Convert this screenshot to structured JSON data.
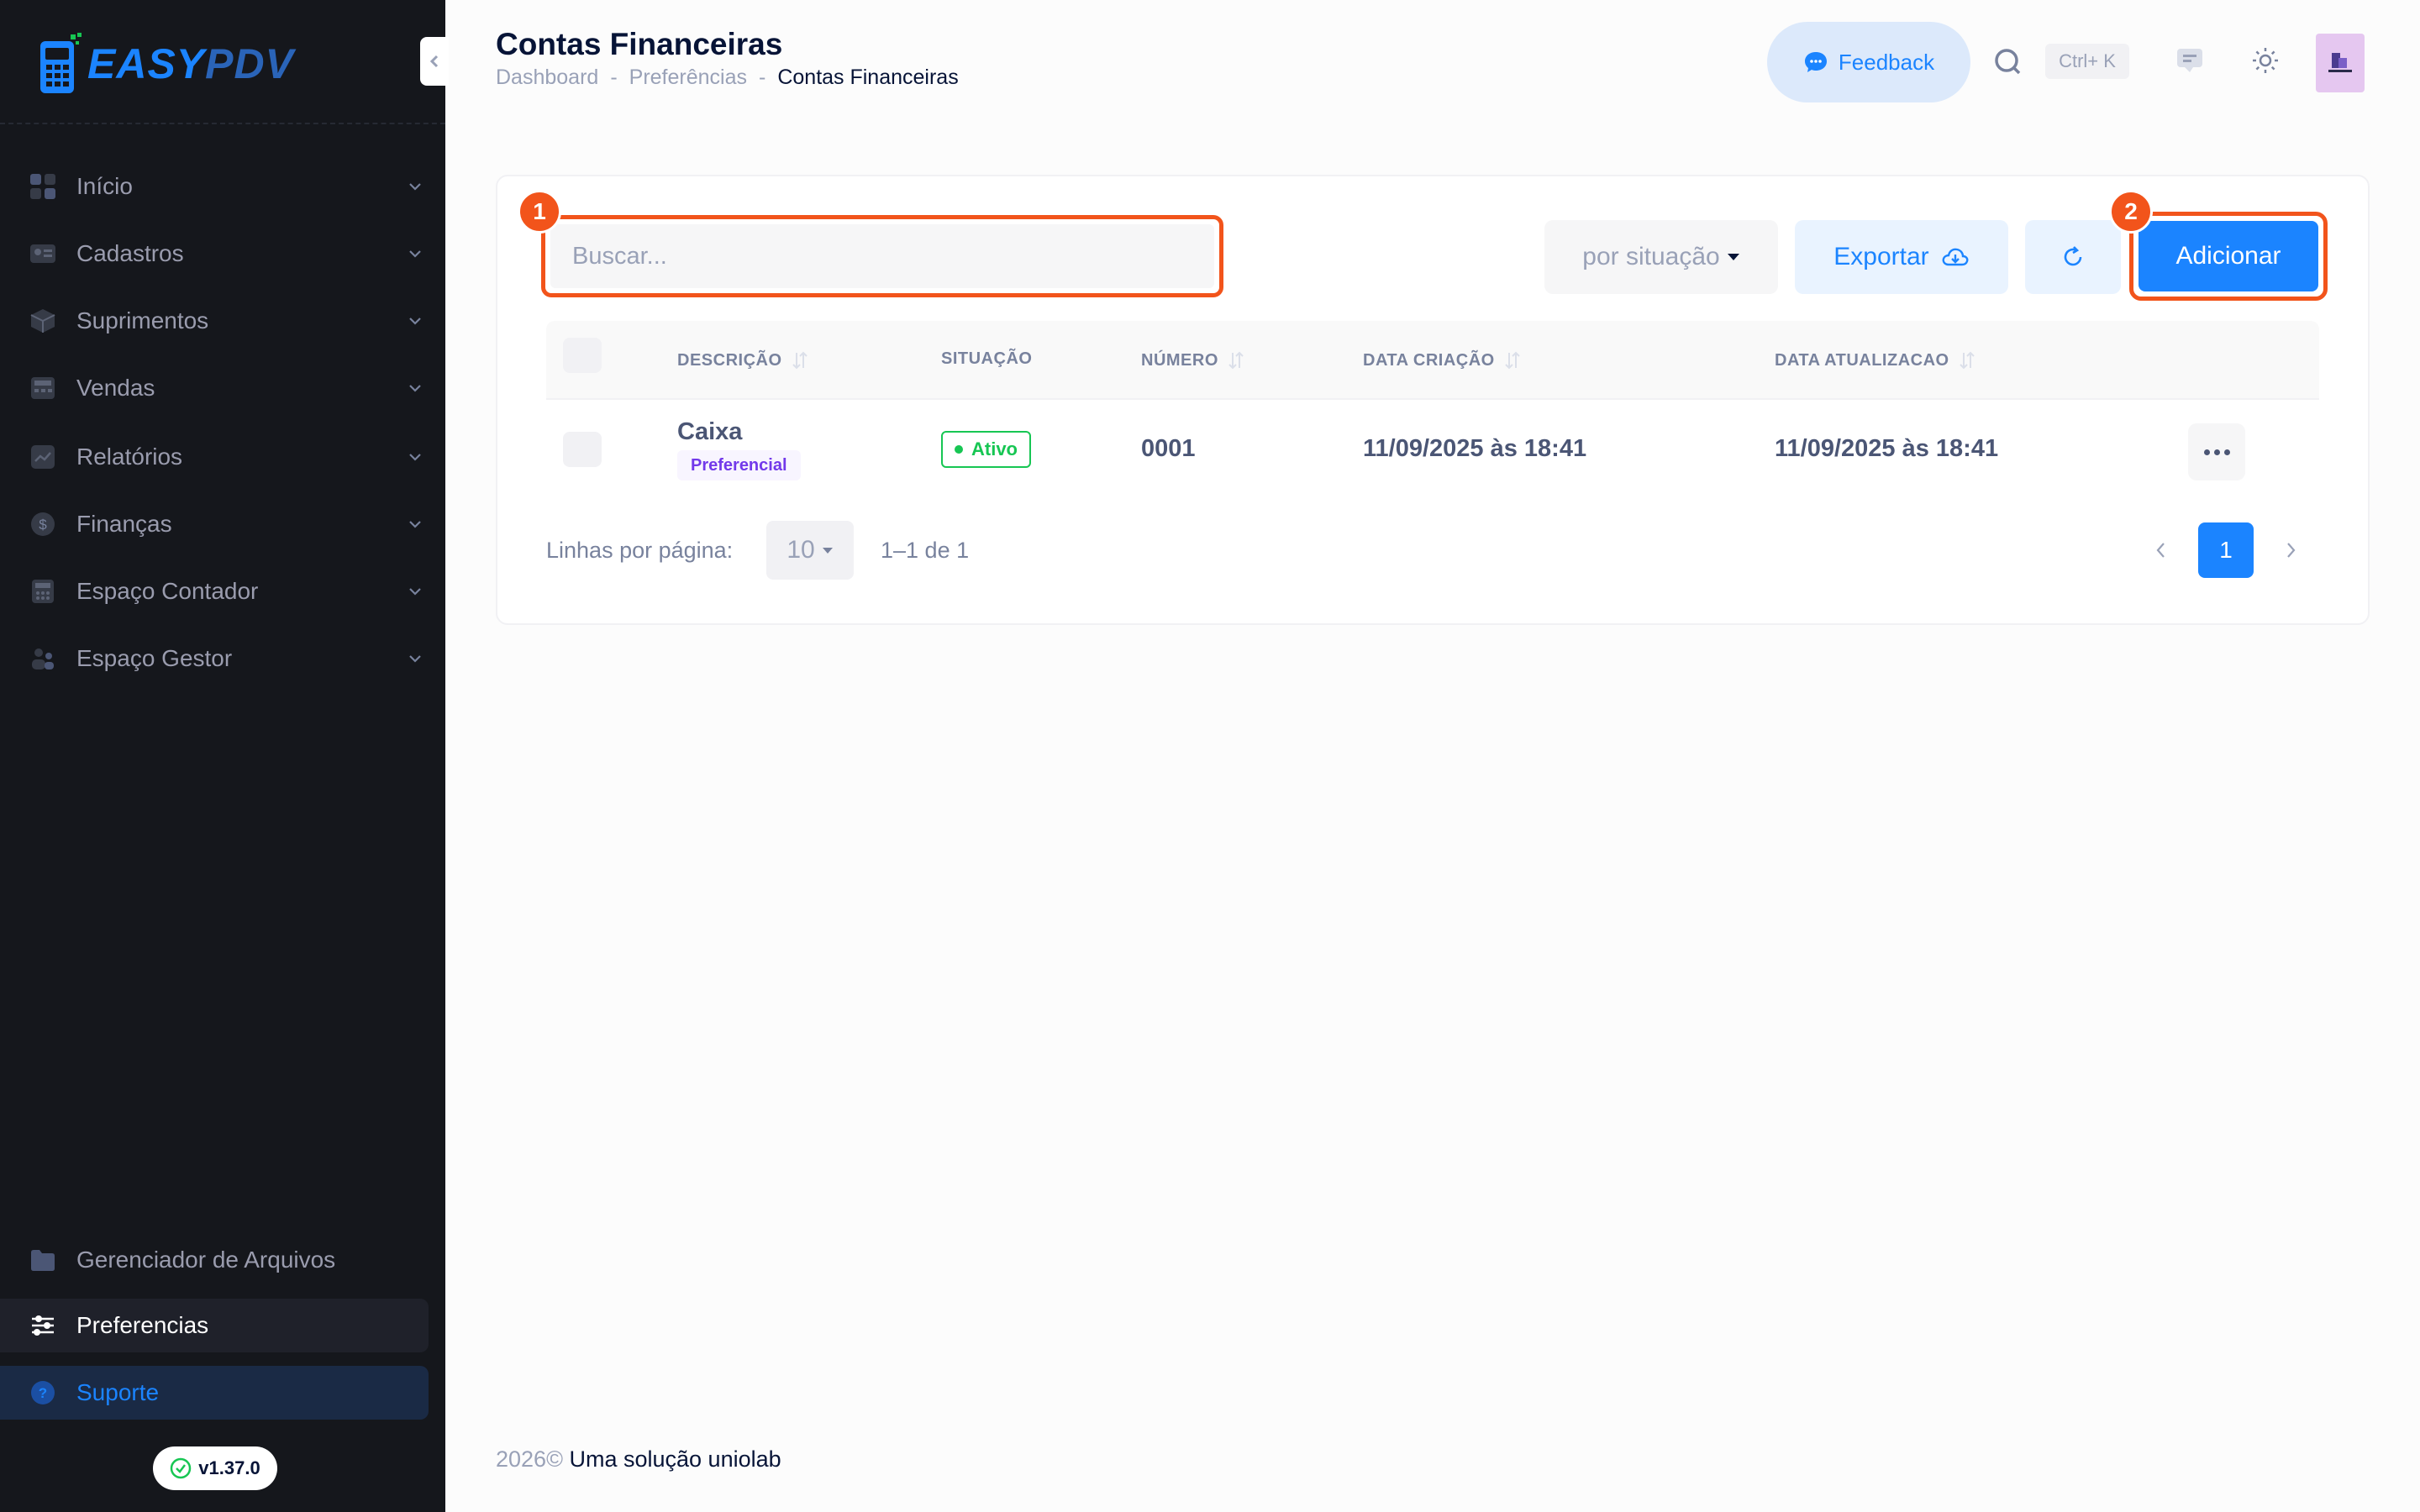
{
  "app": {
    "logo_text_1": "EASY",
    "logo_text_2": "PDV",
    "version": "v1.37.0",
    "colors": {
      "accent": "#1b84ff",
      "highlight": "#f2541b",
      "success": "#17c653",
      "sidebar_bg": "#15171c"
    }
  },
  "sidebar": {
    "items": [
      {
        "label": "Início",
        "icon": "dashboard-icon"
      },
      {
        "label": "Cadastros",
        "icon": "id-card-icon"
      },
      {
        "label": "Suprimentos",
        "icon": "box-icon"
      },
      {
        "label": "Vendas",
        "icon": "cash-register-icon"
      },
      {
        "label": "Relatórios",
        "icon": "chart-line-icon"
      },
      {
        "label": "Finanças",
        "icon": "dollar-icon"
      },
      {
        "label": "Espaço Contador",
        "icon": "calculator-icon"
      },
      {
        "label": "Espaço Gestor",
        "icon": "people-icon"
      }
    ],
    "bottom": {
      "files": "Gerenciador de Arquivos",
      "preferences": "Preferencias",
      "support": "Suporte"
    }
  },
  "header": {
    "title": "Contas Financeiras",
    "breadcrumb": [
      "Dashboard",
      "Preferências",
      "Contas Financeiras"
    ],
    "breadcrumb_sep": "-",
    "feedback_label": "Feedback",
    "search_shortcut": "Ctrl+ K"
  },
  "toolbar": {
    "search_placeholder": "Buscar...",
    "filter_label": "por situação",
    "export_label": "Exportar",
    "add_label": "Adicionar",
    "step_1": "1",
    "step_2": "2"
  },
  "table": {
    "columns": [
      "DESCRIÇÃO",
      "SITUAÇÃO",
      "NÚMERO",
      "DATA CRIAÇÃO",
      "DATA ATUALIZACAO"
    ],
    "rows": [
      {
        "descricao": "Caixa",
        "tag": "Preferencial",
        "situacao": "Ativo",
        "numero": "0001",
        "data_criacao": "11/09/2025 às 18:41",
        "data_atualizacao": "11/09/2025 às 18:41"
      }
    ]
  },
  "pagination": {
    "rows_label": "Linhas por página:",
    "rows_per_page": "10",
    "range": "1–1 de 1",
    "current_page": "1"
  },
  "footer": {
    "year": "2026©",
    "brand": "Uma solução uniolab"
  }
}
